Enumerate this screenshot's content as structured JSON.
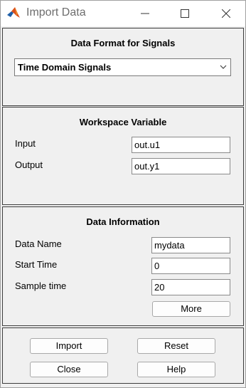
{
  "window": {
    "title": "Import Data"
  },
  "format_panel": {
    "title": "Data Format for Signals",
    "selected": "Time Domain Signals"
  },
  "workspace_panel": {
    "title": "Workspace Variable",
    "input_label": "Input",
    "input_value": "out.u1",
    "output_label": "Output",
    "output_value": "out.y1"
  },
  "info_panel": {
    "title": "Data Information",
    "name_label": "Data Name",
    "name_value": "mydata",
    "start_label": "Start Time",
    "start_value": "0",
    "sample_label": "Sample time",
    "sample_value": "20",
    "more_label": "More"
  },
  "buttons": {
    "import": "Import",
    "reset": "Reset",
    "close": "Close",
    "help": "Help"
  },
  "colors": {
    "panel_bg": "#f0f0f0",
    "panel_border": "#3c3c3c",
    "title_text": "#6d6d6d"
  }
}
